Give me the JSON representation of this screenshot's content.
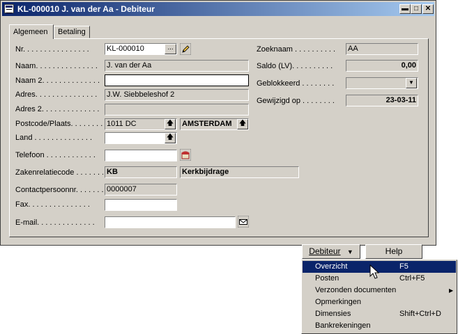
{
  "window": {
    "title": "KL-000010 J. van der Aa - Debiteur"
  },
  "tabs": [
    {
      "label": "Algemeen"
    },
    {
      "label": "Betaling"
    }
  ],
  "labels": {
    "nr": "Nr. . . . . . . . . . . . . . . .",
    "naam": "Naam. . . . . . . . . . . . . . .",
    "naam2": "Naam 2. . . . . . . . . . . . . .",
    "adres": "Adres. . . . . . . . . . . . . . .",
    "adres2": "Adres 2. . . . . . . . . . . . . .",
    "postcode": "Postcode/Plaats. . . . . . . .",
    "land": "Land . . . . . . . . . . . . . .",
    "telefoon": "Telefoon . . . . . . . . . . . .",
    "zakenrelatie": "Zakenrelatiecode . . . . . . .",
    "contact": "Contactpersoonnr. . . . . . . .",
    "fax": "Fax. . . . . . . . . . . . . . .",
    "email": "E-mail. . . . . . . . . . . . . .",
    "zoeknaam": "Zoeknaam . . . . . . . . . .",
    "saldo": "Saldo (LV). . . . . . . . . .",
    "geblokkeerd": "Geblokkeerd . . . . . . . .",
    "gewijzigd": "Gewijzigd op . . . . . . . ."
  },
  "values": {
    "nr": "KL-000010",
    "naam": "J. van der Aa",
    "naam2": "",
    "adres": "J.W. Siebbeleshof 2",
    "adres2": "",
    "postcode": "1011 DC",
    "plaats": "AMSTERDAM",
    "land": "",
    "telefoon": "",
    "zakenrelatiecode": "KB",
    "zakenrelatie_naam": "Kerkbijdrage",
    "contactpersoonnr": "0000007",
    "fax": "",
    "email": "",
    "zoeknaam": "AA",
    "saldo": "0,00",
    "geblokkeerd": "",
    "gewijzigd": "23-03-11"
  },
  "buttons": {
    "ellipsis": "...",
    "debiteur": "Debiteur",
    "help": "Help"
  },
  "menu": [
    {
      "label": "Overzicht",
      "shortcut": "F5",
      "selected": true
    },
    {
      "label": "Posten",
      "shortcut": "Ctrl+F5"
    },
    {
      "label": "Verzonden documenten",
      "shortcut": "",
      "submenu": true
    },
    {
      "label": "Opmerkingen",
      "shortcut": ""
    },
    {
      "label": "Dimensies",
      "shortcut": "Shift+Ctrl+D"
    },
    {
      "label": "Bankrekeningen",
      "shortcut": ""
    }
  ],
  "icons": {
    "window": "form-icon",
    "minimize": "minimize-icon",
    "maximize": "maximize-icon",
    "close": "close-icon",
    "edit": "pencil-icon",
    "lookup": "up-arrow-icon",
    "phone": "phone-icon",
    "email": "envelope-icon",
    "dropdown": "dropdown-arrow-icon",
    "cursor": "mouse-pointer-icon"
  },
  "colors": {
    "titlebar_start": "#0a246a",
    "titlebar_end": "#a6caf0",
    "face": "#d4d0c8",
    "menu_highlight": "#0a246a"
  }
}
